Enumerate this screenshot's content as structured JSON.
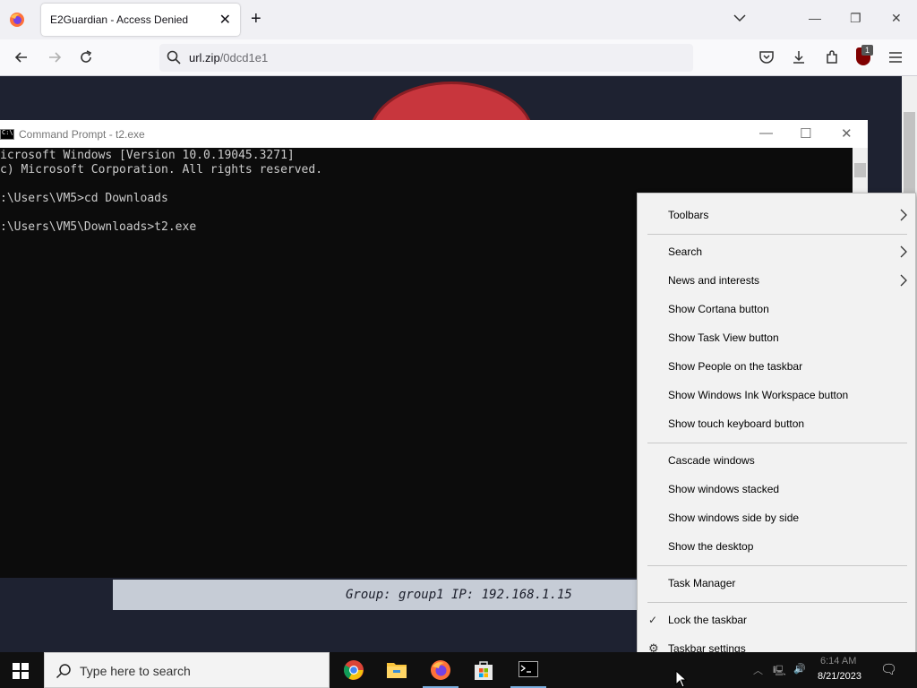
{
  "browser": {
    "tab_title": "E2Guardian - Access Denied",
    "tab_close": "✕",
    "new_tab": "+",
    "url_host": "url.zip",
    "url_path": "/0dcd1e1",
    "ublock_count": "1"
  },
  "page": {
    "group_info": "Group: group1   IP: 192.168.1.15"
  },
  "cmd": {
    "title": "Command Prompt - t2.exe",
    "lines": [
      "icrosoft Windows [Version 10.0.19045.3271]",
      "c) Microsoft Corporation. All rights reserved.",
      "",
      ":\\Users\\VM5>cd Downloads",
      "",
      ":\\Users\\VM5\\Downloads>t2.exe"
    ]
  },
  "context_menu": {
    "items": [
      {
        "label": "Toolbars",
        "submenu": true
      },
      {
        "label": "Search",
        "submenu": true
      },
      {
        "label": "News and interests",
        "submenu": true
      },
      {
        "label": "Show Cortana button"
      },
      {
        "label": "Show Task View button"
      },
      {
        "label": "Show People on the taskbar"
      },
      {
        "label": "Show Windows Ink Workspace button"
      },
      {
        "label": "Show touch keyboard button"
      },
      {
        "label": "Cascade windows"
      },
      {
        "label": "Show windows stacked"
      },
      {
        "label": "Show windows side by side"
      },
      {
        "label": "Show the desktop"
      },
      {
        "label": "Task Manager"
      },
      {
        "label": "Lock the taskbar",
        "checked": true
      },
      {
        "label": "Taskbar settings",
        "icon": "gear-icon"
      }
    ]
  },
  "taskbar": {
    "search_placeholder": "Type here to search",
    "apps": [
      "chrome-icon",
      "file-explorer-icon",
      "firefox-icon",
      "microsoft-store-icon",
      "command-prompt-icon"
    ],
    "time": "6:14 AM",
    "date": "8/21/2023"
  },
  "colors": {
    "page_bg": "#1e2231",
    "accent": "#c8363d",
    "taskbar": "#101010"
  }
}
